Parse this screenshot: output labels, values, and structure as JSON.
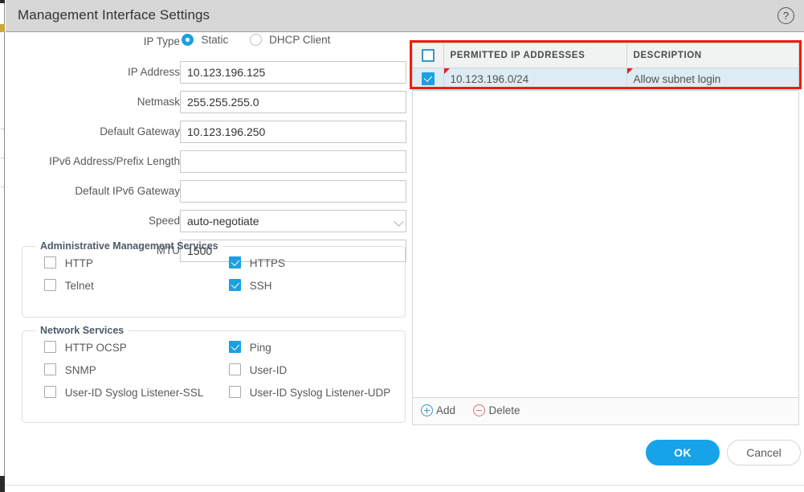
{
  "dialog": {
    "title": "Management Interface Settings",
    "help_icon": "question-mark-icon"
  },
  "form": {
    "ip_type": {
      "label": "IP Type",
      "options": [
        {
          "label": "Static",
          "selected": true
        },
        {
          "label": "DHCP Client",
          "selected": false
        }
      ]
    },
    "fields": [
      {
        "label": "IP Address",
        "value": "10.123.196.125",
        "placeholder": ""
      },
      {
        "label": "Netmask",
        "value": "255.255.255.0",
        "placeholder": ""
      },
      {
        "label": "Default Gateway",
        "value": "10.123.196.250",
        "placeholder": ""
      },
      {
        "label": "IPv6 Address/Prefix Length",
        "value": "",
        "placeholder": ""
      },
      {
        "label": "Default IPv6 Gateway",
        "value": "",
        "placeholder": ""
      }
    ],
    "speed": {
      "label": "Speed",
      "value": "auto-negotiate"
    },
    "mtu": {
      "label": "MTU",
      "value": "1500"
    }
  },
  "admin_services": {
    "legend": "Administrative Management Services",
    "items": [
      {
        "label": "HTTP",
        "checked": false
      },
      {
        "label": "Telnet",
        "checked": false
      },
      {
        "label": "HTTPS",
        "checked": true
      },
      {
        "label": "SSH",
        "checked": true
      }
    ]
  },
  "network_services": {
    "legend": "Network Services",
    "items": [
      {
        "label": "HTTP OCSP",
        "checked": false
      },
      {
        "label": "SNMP",
        "checked": false
      },
      {
        "label": "User-ID Syslog Listener-SSL",
        "checked": false
      },
      {
        "label": "Ping",
        "checked": true
      },
      {
        "label": "User-ID",
        "checked": false
      },
      {
        "label": "User-ID Syslog Listener-UDP",
        "checked": false
      }
    ]
  },
  "ip_table": {
    "columns": [
      "PERMITTED IP ADDRESSES",
      "DESCRIPTION"
    ],
    "header_checkbox_checked": false,
    "rows": [
      {
        "checked": true,
        "permitted_ip": "10.123.196.0/24",
        "description": "Allow subnet login"
      }
    ],
    "toolbar": [
      {
        "label": "Add",
        "icon": "plus-circle-icon"
      },
      {
        "label": "Delete",
        "icon": "minus-circle-icon"
      }
    ]
  },
  "footer": {
    "ok_label": "OK",
    "cancel_label": "Cancel"
  },
  "colors": {
    "accent": "#17a3e8",
    "checkbox_checked": "#1ba0e1",
    "highlight_border": "#ee1c0e",
    "row_selected_bg": "#dcecf5",
    "titlebar_bg": "#d7d7d7"
  }
}
